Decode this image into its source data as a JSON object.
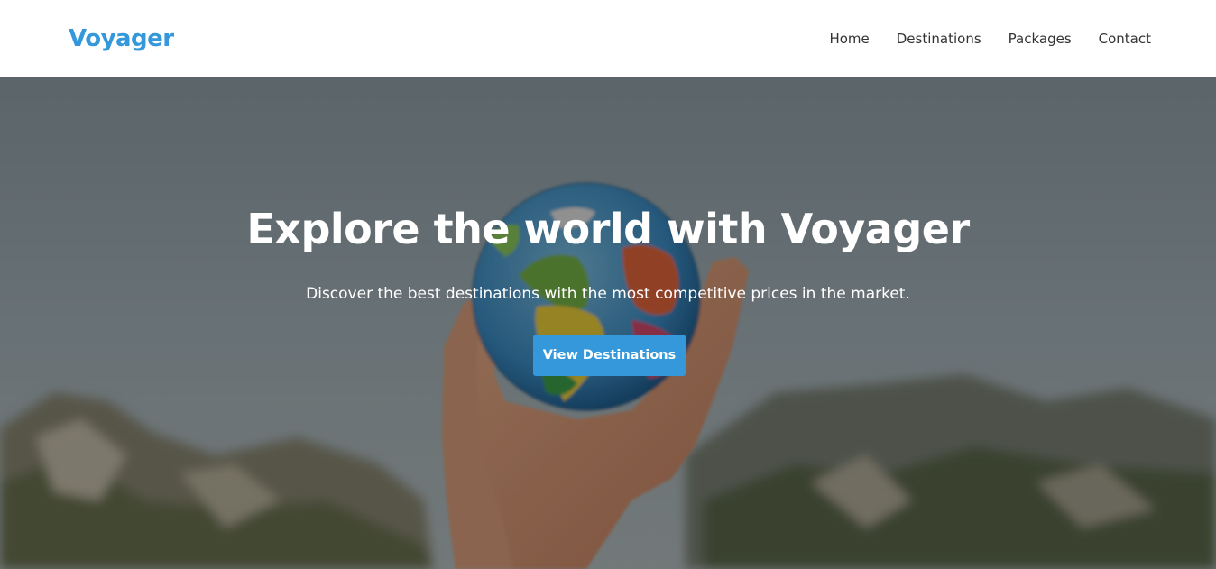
{
  "navbar": {
    "brand": "Voyager",
    "links": [
      {
        "label": "Home"
      },
      {
        "label": "Destinations"
      },
      {
        "label": "Packages"
      },
      {
        "label": "Contact"
      }
    ]
  },
  "hero": {
    "title": "Explore the world with Voyager",
    "subtitle": "Discover the best destinations with the most competitive prices in the market.",
    "cta_label": "View Destinations",
    "background_image": "hand-holding-globe-over-mountains"
  },
  "colors": {
    "accent": "#3498db",
    "nav_text": "#333333",
    "hero_text": "#ffffff"
  }
}
